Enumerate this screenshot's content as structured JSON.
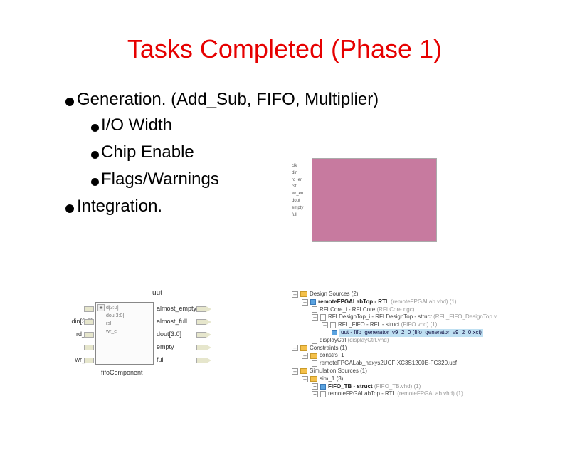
{
  "title": "Tasks Completed (Phase 1)",
  "bullets": {
    "generation": "Generation. (Add_Sub, FIFO, Multiplier)",
    "io_width": "I/O Width",
    "chip_enable": "Chip Enable",
    "flags": "Flags/Warnings",
    "integration": "Integration."
  },
  "schematic": {
    "top": "uut",
    "inputs": [
      "clk",
      "din[3:0]",
      "rd_en",
      "rst",
      "wr_en"
    ],
    "inner": [
      "d[3:0]",
      "dou[3:0]",
      "rsl",
      "wr_e"
    ],
    "inner_right": [
      "almost_empty",
      "almost_full",
      "d[3:0]",
      "empty",
      "full"
    ],
    "outputs": [
      "almost_empty",
      "almost_full",
      "dout[3:0]",
      "empty",
      "full"
    ],
    "bottom": "fifoComponent"
  },
  "tree": {
    "n0": "Design Sources (2)",
    "n1": "remoteFPGALabTop - RTL",
    "n1g": "(remoteFPGALab.vhd) (1)",
    "n2": "RFLCore_i - RFLCore",
    "n2g": "(RFLCore.ngc)",
    "n3": "RFLDesignTop_i - RFLDesignTop - struct",
    "n3g": "(RFL_FIFO_DesignTop.v…",
    "n4": "RFL_FIFO - RFL - struct",
    "n4g": "(FIFO.vhd) (1)",
    "n5": "uut - fifo_generator_v9_2_0",
    "n5g": "(fifo_generator_v9_2_0.xci)",
    "n6": "displayCtrl",
    "n6g": "(displayCtrl.vhd)",
    "n7": "Constraints (1)",
    "n8": "constrs_1",
    "n9": "remoteFPGALab_nexys2UCF-XC3S1200E-FG320.ucf",
    "n10": "Simulation Sources (1)",
    "n11": "sim_1 (3)",
    "n12": "FIFO_TB - struct",
    "n12g": "(FIFO_TB.vhd) (1)",
    "n13": "remoteFPGALabTop - RTL",
    "n13g": "(remoteFPGALab.vhd) (1)"
  }
}
